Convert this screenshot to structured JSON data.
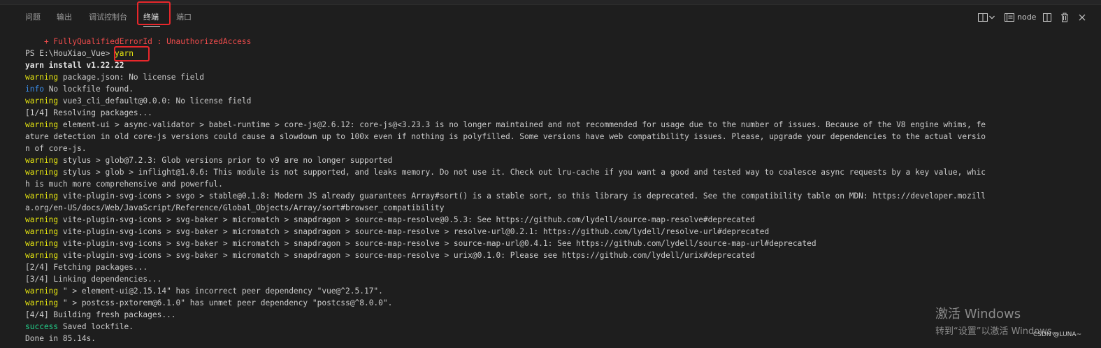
{
  "panel": {
    "tabs": [
      {
        "label": "问题"
      },
      {
        "label": "输出"
      },
      {
        "label": "调试控制台"
      },
      {
        "label": "终端"
      },
      {
        "label": "端口"
      }
    ],
    "active_tab": "终端",
    "toolbar": {
      "terminal_name": "node",
      "icons": [
        "split-terminal-icon",
        "chevron-down-icon",
        "terminal-icon",
        "split-editor-icon",
        "trash-icon",
        "close-icon"
      ]
    }
  },
  "terminal": {
    "prompt": "PS E:\\HouXiao_Vue> ",
    "command": "yarn",
    "error_line": "    + FullyQualifiedErrorId : UnauthorizedAccess",
    "lines": [
      {
        "kind": "bold",
        "text": "yarn install v1.22.22"
      },
      {
        "kind": "warning",
        "text": " package.json: No license field"
      },
      {
        "kind": "info",
        "text": " No lockfile found."
      },
      {
        "kind": "warning",
        "text": " vue3_cli_default@0.0.0: No license field"
      },
      {
        "kind": "plain",
        "text": "[1/4] Resolving packages..."
      },
      {
        "kind": "warning",
        "text": " element-ui > async-validator > babel-runtime > core-js@2.6.12: core-js@<3.23.3 is no longer maintained and not recommended for usage due to the number of issues. Because of the V8 engine whims, fe"
      },
      {
        "kind": "plain",
        "text": "ature detection in old core-js versions could cause a slowdown up to 100x even if nothing is polyfilled. Some versions have web compatibility issues. Please, upgrade your dependencies to the actual versio"
      },
      {
        "kind": "plain",
        "text": "n of core-js."
      },
      {
        "kind": "warning",
        "text": " stylus > glob@7.2.3: Glob versions prior to v9 are no longer supported"
      },
      {
        "kind": "warning",
        "text": " stylus > glob > inflight@1.0.6: This module is not supported, and leaks memory. Do not use it. Check out lru-cache if you want a good and tested way to coalesce async requests by a key value, whic"
      },
      {
        "kind": "plain",
        "text": "h is much more comprehensive and powerful."
      },
      {
        "kind": "warning",
        "text": " vite-plugin-svg-icons > svgo > stable@0.1.8: Modern JS already guarantees Array#sort() is a stable sort, so this library is deprecated. See the compatibility table on MDN: https://developer.mozill"
      },
      {
        "kind": "plain",
        "text": "a.org/en-US/docs/Web/JavaScript/Reference/Global_Objects/Array/sort#browser_compatibility"
      },
      {
        "kind": "warning",
        "text": " vite-plugin-svg-icons > svg-baker > micromatch > snapdragon > source-map-resolve@0.5.3: See https://github.com/lydell/source-map-resolve#deprecated"
      },
      {
        "kind": "warning",
        "text": " vite-plugin-svg-icons > svg-baker > micromatch > snapdragon > source-map-resolve > resolve-url@0.2.1: https://github.com/lydell/resolve-url#deprecated"
      },
      {
        "kind": "warning",
        "text": " vite-plugin-svg-icons > svg-baker > micromatch > snapdragon > source-map-resolve > source-map-url@0.4.1: See https://github.com/lydell/source-map-url#deprecated"
      },
      {
        "kind": "warning",
        "text": " vite-plugin-svg-icons > svg-baker > micromatch > snapdragon > source-map-resolve > urix@0.1.0: Please see https://github.com/lydell/urix#deprecated"
      },
      {
        "kind": "plain",
        "text": "[2/4] Fetching packages..."
      },
      {
        "kind": "plain",
        "text": "[3/4] Linking dependencies..."
      },
      {
        "kind": "warning",
        "text": " \" > element-ui@2.15.14\" has incorrect peer dependency \"vue@^2.5.17\"."
      },
      {
        "kind": "warning",
        "text": " \" > postcss-pxtorem@6.1.0\" has unmet peer dependency \"postcss@^8.0.0\"."
      },
      {
        "kind": "plain",
        "text": "[4/4] Building fresh packages..."
      },
      {
        "kind": "success",
        "text": " Saved lockfile."
      },
      {
        "kind": "plain",
        "text": "Done in 85.14s."
      }
    ],
    "labels": {
      "warning": "warning",
      "info": "info",
      "success": "success"
    }
  },
  "watermark": {
    "title": "激活 Windows",
    "subtitle": "转到“设置”以激活 Windows。",
    "credit": "CSDN @LUNA~"
  },
  "colors": {
    "background": "#1e1e1e",
    "warning": "#e5e510",
    "info": "#3b8eea",
    "success": "#23d18b",
    "error": "#f14c4c",
    "highlight": "#e8272b"
  }
}
